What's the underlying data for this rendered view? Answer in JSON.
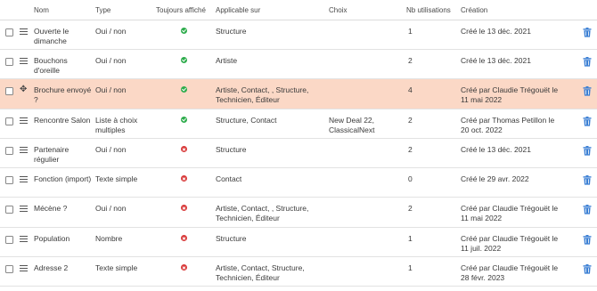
{
  "columns": {
    "nom": "Nom",
    "type": "Type",
    "toujours": "Toujours affiché",
    "applicable": "Applicable sur",
    "choix": "Choix",
    "nb": "Nb utilisations",
    "creation": "Création"
  },
  "colors": {
    "ok": "#2eac4c",
    "ko": "#d93b3b",
    "highlight": "#fbd8c6",
    "trash": "#3b7fd4"
  },
  "rows": [
    {
      "nom": "Ouverte le dimanche",
      "type": "Oui / non",
      "toujours": "yes",
      "applicable": "Structure",
      "choix": "",
      "nb": "1",
      "creation": "Créé le 13 déc. 2021",
      "highlight": false
    },
    {
      "nom": "Bouchons d'oreille",
      "type": "Oui / non",
      "toujours": "yes",
      "applicable": "Artiste",
      "choix": "",
      "nb": "2",
      "creation": "Créé le 13 déc. 2021",
      "highlight": false
    },
    {
      "nom": "Brochure envoyé ?",
      "type": "Oui / non",
      "toujours": "yes",
      "applicable": "Artiste, Contact, , Structure, Technicien, Éditeur",
      "choix": "",
      "nb": "4",
      "creation": "Créé par Claudie Trégouët le 11 mai 2022",
      "highlight": true
    },
    {
      "nom": "Rencontre Salon",
      "type": "Liste à choix multiples",
      "toujours": "yes",
      "applicable": "Structure, Contact",
      "choix": "New Deal 22, ClassicalNext",
      "nb": "2",
      "creation": "Créé par Thomas Petillon le 20 oct. 2022",
      "highlight": false
    },
    {
      "nom": "Partenaire régulier",
      "type": "Oui / non",
      "toujours": "no",
      "applicable": "Structure",
      "choix": "",
      "nb": "2",
      "creation": "Créé le 13 déc. 2021",
      "highlight": false
    },
    {
      "nom": "Fonction (import)",
      "type": "Texte simple",
      "toujours": "no",
      "applicable": "Contact",
      "choix": "",
      "nb": "0",
      "creation": "Créé le 29 avr. 2022",
      "highlight": false
    },
    {
      "nom": "Mécène ?",
      "type": "Oui / non",
      "toujours": "no",
      "applicable": "Artiste, Contact, , Structure, Technicien, Éditeur",
      "choix": "",
      "nb": "2",
      "creation": "Créé par Claudie Trégouët le 11 mai 2022",
      "highlight": false
    },
    {
      "nom": "Population",
      "type": "Nombre",
      "toujours": "no",
      "applicable": "Structure",
      "choix": "",
      "nb": "1",
      "creation": "Créé par Claudie Trégouët le 11 juil. 2022",
      "highlight": false
    },
    {
      "nom": "Adresse 2",
      "type": "Texte simple",
      "toujours": "no",
      "applicable": "Artiste, Contact, Structure, Technicien, Éditeur",
      "choix": "",
      "nb": "1",
      "creation": "Créé par Claudie Trégouët le 28 févr. 2023",
      "highlight": false
    }
  ]
}
